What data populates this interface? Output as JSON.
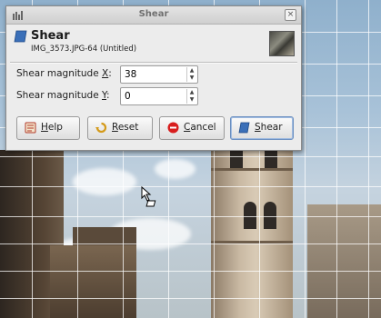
{
  "window": {
    "title": "Shear",
    "close_glyph": "×"
  },
  "header": {
    "title": "Shear",
    "subtitle": "IMG_3573.JPG-64 (Untitled)",
    "icon": "shear-tool-icon"
  },
  "fields": [
    {
      "label_pre": "Shear magnitude ",
      "label_key": "X",
      "label_post": ":",
      "value": "38"
    },
    {
      "label_pre": "Shear magnitude ",
      "label_key": "Y",
      "label_post": ":",
      "value": "0"
    }
  ],
  "buttons": {
    "help": {
      "key": "H",
      "rest": "elp"
    },
    "reset": {
      "key": "R",
      "rest": "eset"
    },
    "cancel": {
      "key": "C",
      "rest": "ancel"
    },
    "shear": {
      "key": "S",
      "rest": "hear"
    }
  },
  "spin_up_glyph": "▲",
  "spin_down_glyph": "▼",
  "colors": {
    "dialog_bg": "#ececec",
    "cancel_icon": "#d81e1e",
    "shear_accent": "#6a8ec0"
  }
}
